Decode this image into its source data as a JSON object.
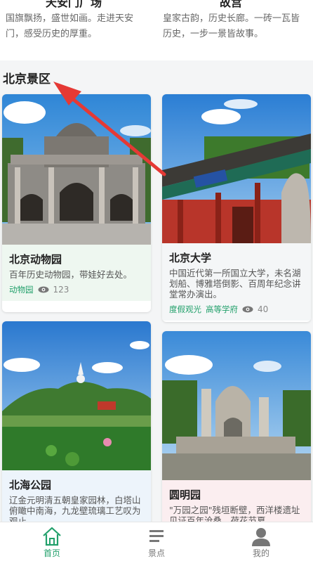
{
  "top_cards": [
    {
      "title": "天安门广场",
      "desc": "国旗飘扬，盛世如画。走进天安门，感受历史的厚重。"
    },
    {
      "title": "故宫",
      "desc": "皇家古韵，历史长廊。一砖一瓦皆历史，一步一景皆故事。"
    }
  ],
  "section": {
    "title": "北京景区"
  },
  "scenic": [
    {
      "name": "北京动物园",
      "desc": "百年历史动物园，带娃好去处。",
      "tags": [
        "动物园"
      ],
      "views": "123"
    },
    {
      "name": "北京大学",
      "desc": "中国近代第一所国立大学，未名湖划船、博雅塔倒影、百周年纪念讲堂常办演出。",
      "tags": [
        "度假观光",
        "高等学府"
      ],
      "views": "40"
    },
    {
      "name": "北海公园",
      "desc": "辽金元明清五朝皇家园林，白塔山俯瞰中南海，九龙壁琉璃工艺叹为观止。",
      "tags": [],
      "views": ""
    },
    {
      "name": "圆明园",
      "desc": "\"万园之园\"残垣断壁，西洋楼遗址见证百年沧桑，荷花节夏",
      "tags": [],
      "views": ""
    }
  ],
  "nav": [
    {
      "label": "首页",
      "icon": "home-icon",
      "active": true
    },
    {
      "label": "景点",
      "icon": "list-icon",
      "active": false
    },
    {
      "label": "我的",
      "icon": "user-icon",
      "active": false
    }
  ],
  "colors": {
    "accent": "#22a06b",
    "annotation_arrow": "#e53935"
  }
}
